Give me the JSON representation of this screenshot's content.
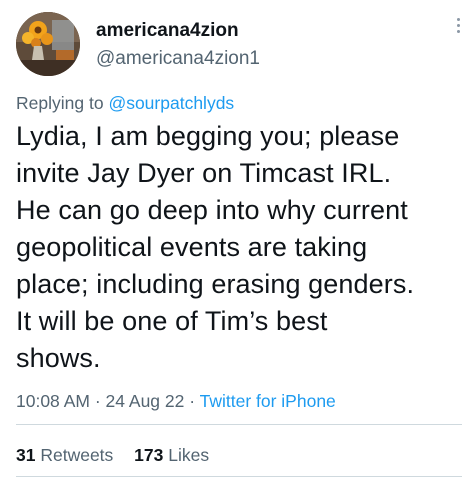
{
  "author": {
    "display_name": "americana4zion",
    "handle": "@americana4zion1",
    "avatar_icon": "sunflower-vase-avatar"
  },
  "reply": {
    "prefix": "Replying to",
    "to": "@sourpatchlyds"
  },
  "tweet": {
    "lines": [
      "Lydia, I am begging you; please",
      "invite Jay Dyer on Timcast IRL.",
      "He can go deep into why current",
      "geopolitical events are taking",
      "place; including erasing genders.",
      "It will be one of Tim’s best",
      "shows."
    ]
  },
  "meta": {
    "time": "10:08 AM",
    "date": "24 Aug 22",
    "separator": "·",
    "source": "Twitter for iPhone"
  },
  "stats": {
    "retweets_count": "31",
    "retweets_label": "Retweets",
    "likes_count": "173",
    "likes_label": "Likes"
  },
  "colors": {
    "accent": "#1d9bf0",
    "secondary_text": "#536471",
    "primary_text": "#0f1419",
    "divider": "#cfd9de"
  }
}
